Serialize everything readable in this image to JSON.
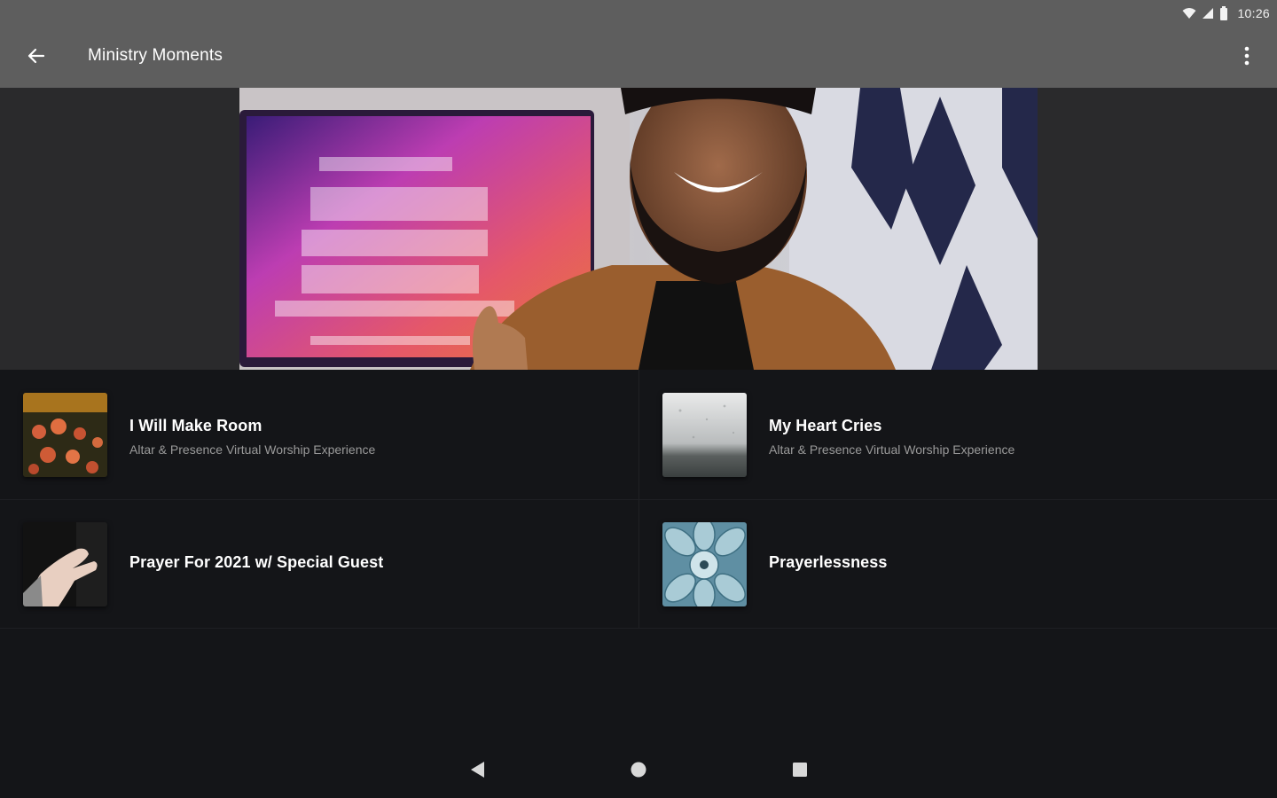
{
  "status_bar": {
    "time": "10:26",
    "icons": [
      "wifi-icon",
      "signal-icon",
      "battery-icon"
    ]
  },
  "app_bar": {
    "title": "Ministry Moments",
    "back_icon": "arrow-back-icon",
    "menu_icon": "more-vert-icon"
  },
  "hero": {
    "image": "featured-worship-leader-photo"
  },
  "items": [
    {
      "title": "I Will Make Room",
      "subtitle": "Altar & Presence Virtual Worship Experience",
      "thumbnail": "flowers-thumbnail"
    },
    {
      "title": "My Heart Cries",
      "subtitle": "Altar & Presence Virtual Worship Experience",
      "thumbnail": "rainy-window-thumbnail"
    },
    {
      "title": "Prayer For 2021 w/ Special Guest",
      "subtitle": "",
      "thumbnail": "open-hand-thumbnail"
    },
    {
      "title": "Prayerlessness",
      "subtitle": "",
      "thumbnail": "succulent-thumbnail"
    }
  ],
  "nav_bar": {
    "icons": [
      "back-triangle-icon",
      "home-circle-icon",
      "recents-square-icon"
    ]
  },
  "colors": {
    "app_bar": "#5e5e5e",
    "background": "#141518",
    "subtitle": "#9a9a9a"
  }
}
